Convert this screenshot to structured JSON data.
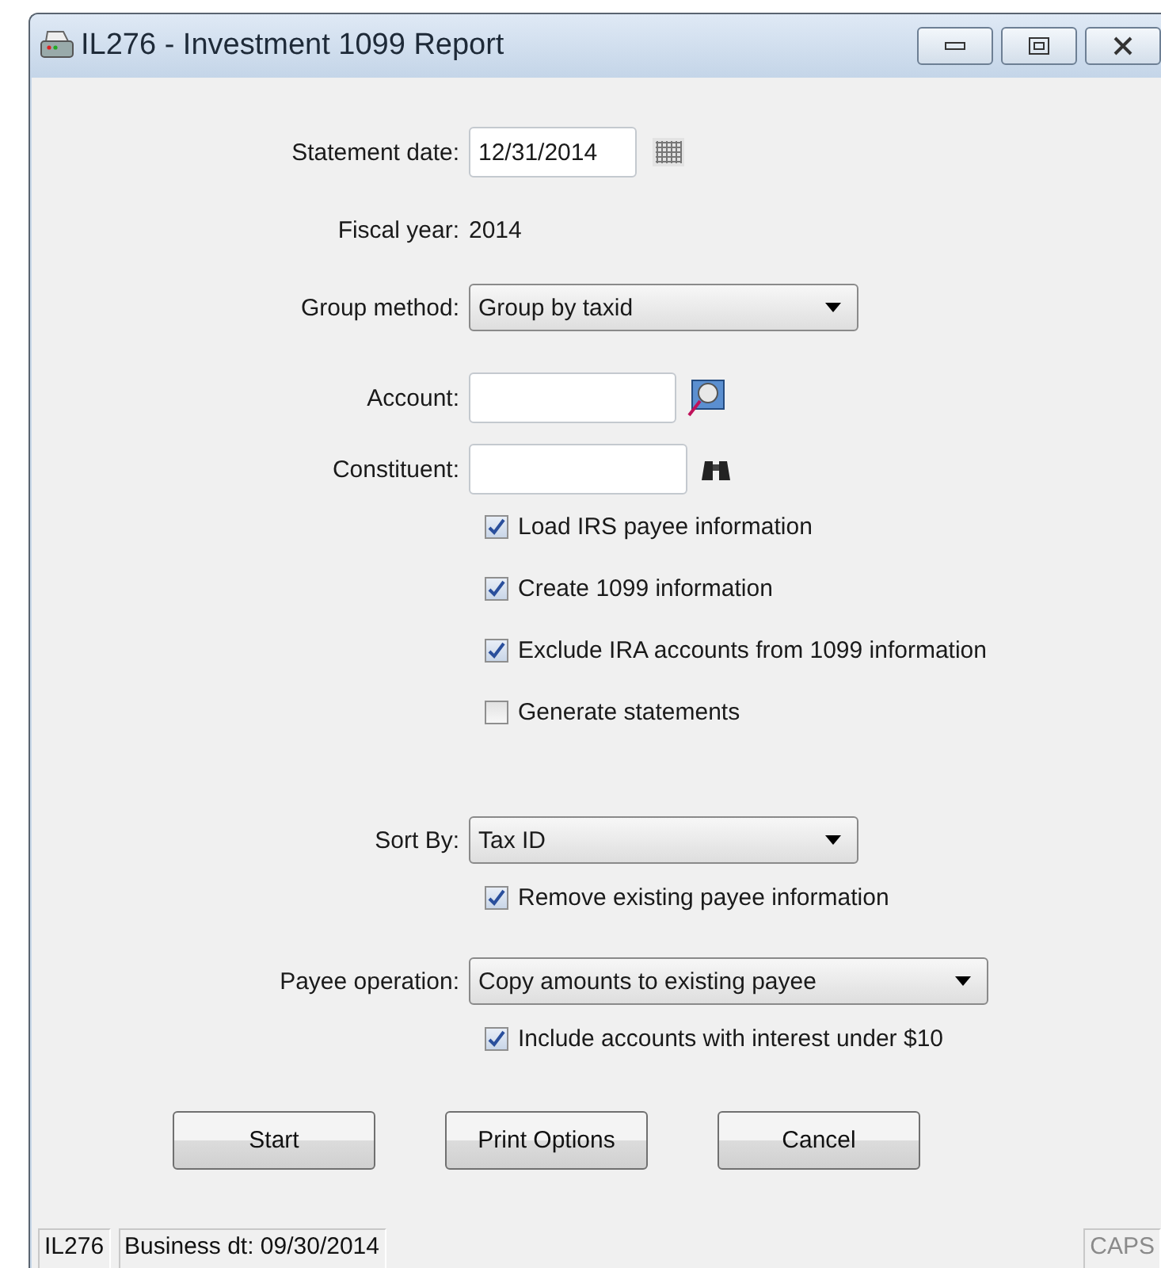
{
  "window": {
    "title": "IL276 - Investment 1099 Report"
  },
  "sections": [
    {
      "rows": [
        {
          "kind": "date",
          "label": "Statement date:",
          "value": "12/31/2014"
        },
        {
          "kind": "value",
          "label": "Fiscal year:",
          "value": "2014"
        },
        {
          "kind": "select",
          "label": "Group method:",
          "value": "Group by taxid"
        },
        {
          "kind": "search",
          "label": "Account:"
        },
        {
          "kind": "find",
          "label": "Constituent:"
        },
        {
          "kind": "checkbox",
          "label": "Load IRS payee information",
          "checked": true
        },
        {
          "kind": "checkbox",
          "label": "Create 1099 information",
          "checked": true
        },
        {
          "kind": "checkbox",
          "label": "Exclude IRA accounts from 1099 information",
          "checked": true
        },
        {
          "kind": "checkbox",
          "label": "Generate statements",
          "checked": false
        }
      ]
    },
    {
      "rows": [
        {
          "kind": "select",
          "label": "Sort By:",
          "value": "Tax ID"
        },
        {
          "kind": "checkbox",
          "label": "Remove existing payee information",
          "checked": true
        },
        {
          "kind": "wideselect",
          "label": "Payee operation:",
          "value": "Copy amounts to existing payee"
        },
        {
          "kind": "checkbox",
          "label": "Include accounts with interest under $10",
          "checked": true
        }
      ]
    }
  ],
  "buttons": [
    "Start",
    "Print Options",
    "Cancel"
  ],
  "status_bar": {
    "code": "IL276",
    "business_date": "Business dt: 09/30/2014",
    "caps": "CAPS"
  }
}
